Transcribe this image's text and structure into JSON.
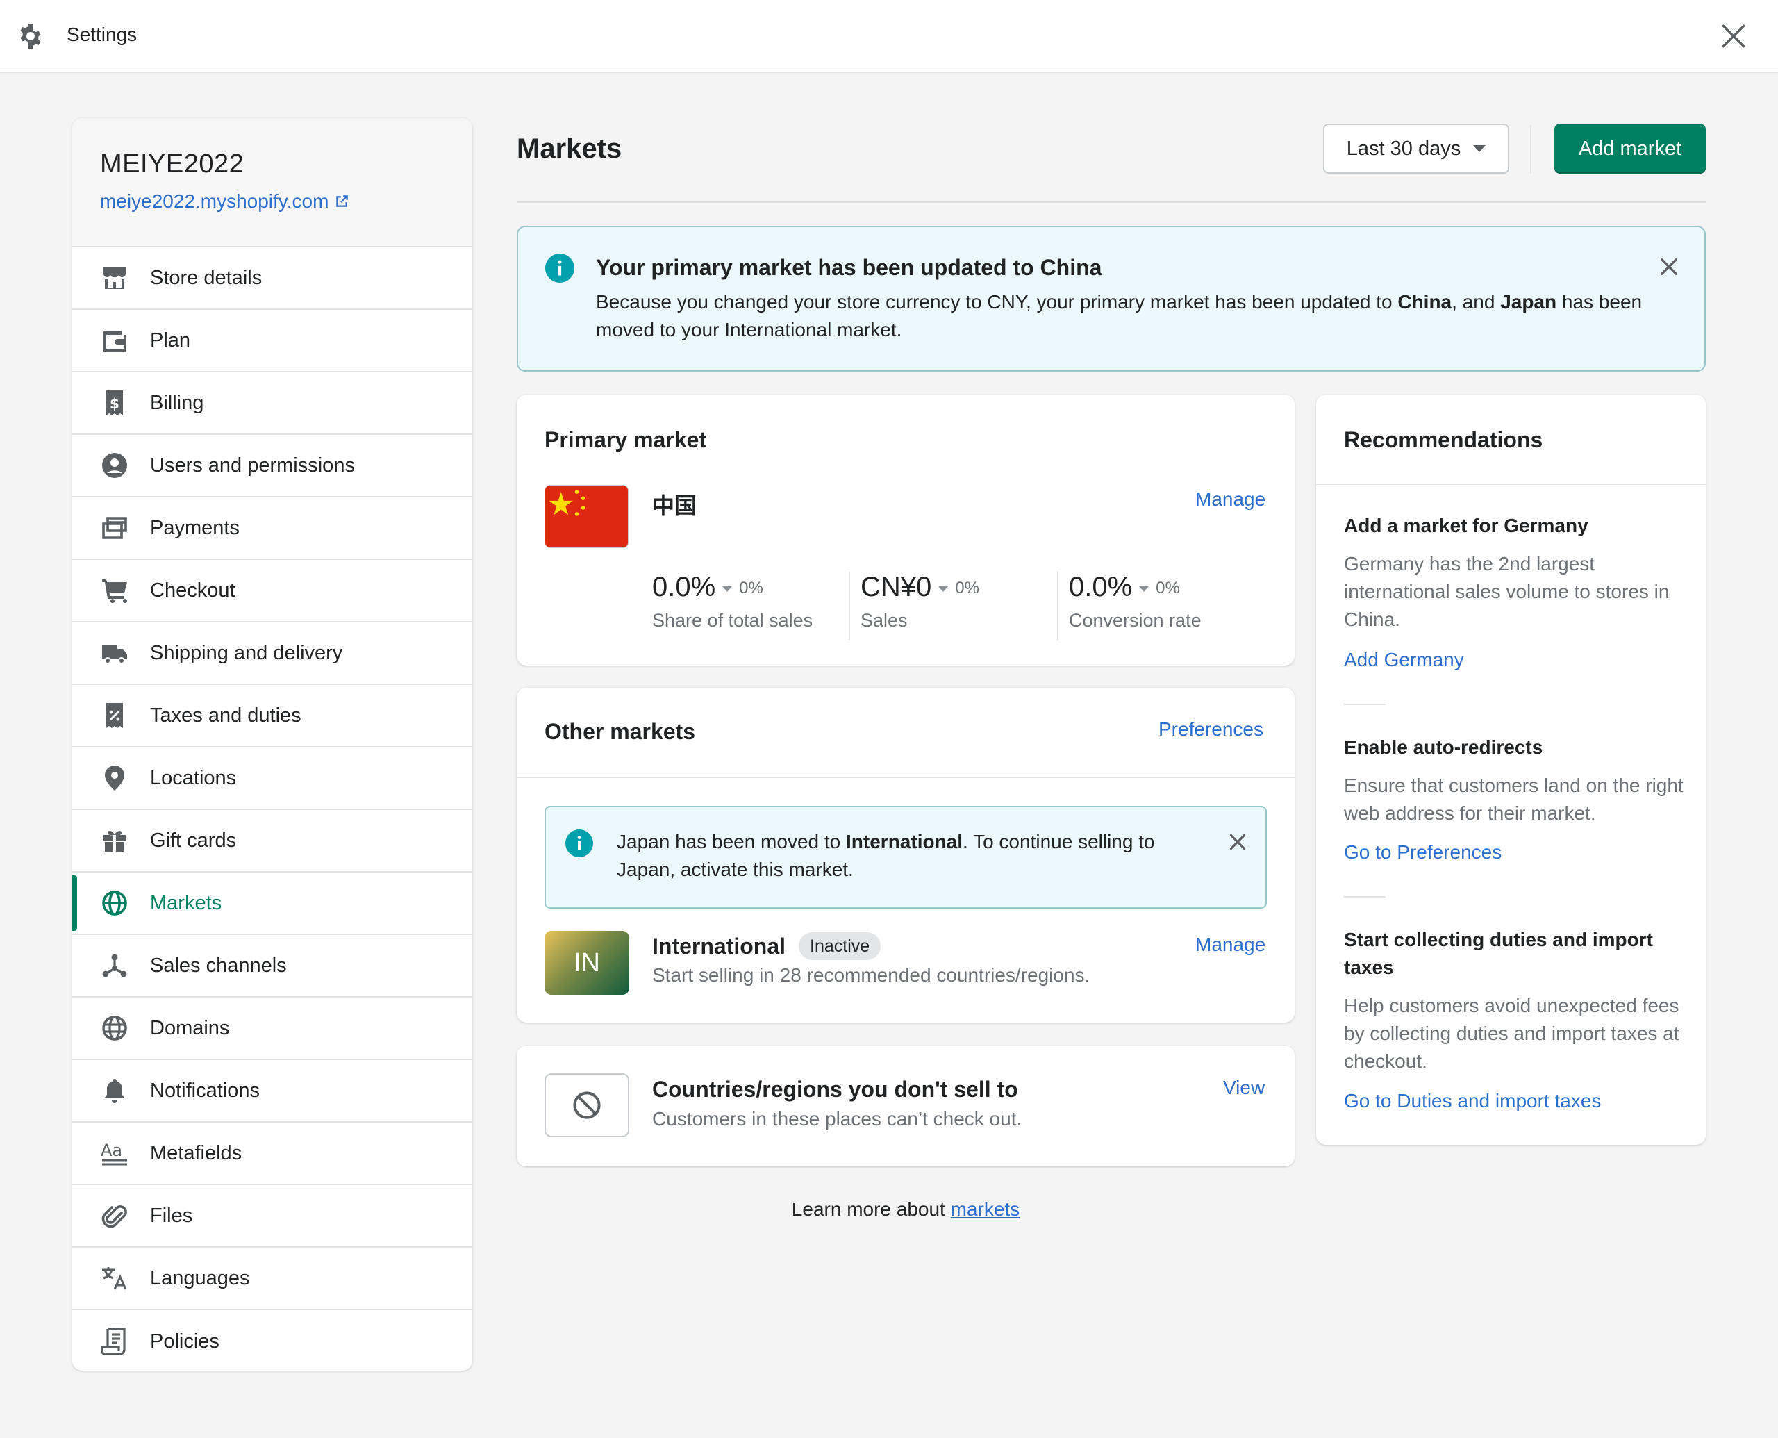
{
  "topbar": {
    "title": "Settings"
  },
  "store": {
    "name": "MEIYE2022",
    "url": "meiye2022.myshopify.com"
  },
  "sidebar": {
    "items": [
      {
        "label": "Store details",
        "icon": "store-icon"
      },
      {
        "label": "Plan",
        "icon": "wallet-icon"
      },
      {
        "label": "Billing",
        "icon": "receipt-dollar-icon"
      },
      {
        "label": "Users and permissions",
        "icon": "user-circle-icon"
      },
      {
        "label": "Payments",
        "icon": "credit-card-icon"
      },
      {
        "label": "Checkout",
        "icon": "cart-icon"
      },
      {
        "label": "Shipping and delivery",
        "icon": "truck-icon"
      },
      {
        "label": "Taxes and duties",
        "icon": "receipt-percent-icon"
      },
      {
        "label": "Locations",
        "icon": "location-pin-icon"
      },
      {
        "label": "Gift cards",
        "icon": "gift-icon"
      },
      {
        "label": "Markets",
        "icon": "globe-icon",
        "active": true
      },
      {
        "label": "Sales channels",
        "icon": "channels-icon"
      },
      {
        "label": "Domains",
        "icon": "domain-globe-icon"
      },
      {
        "label": "Notifications",
        "icon": "bell-icon"
      },
      {
        "label": "Metafields",
        "icon": "metafields-icon"
      },
      {
        "label": "Files",
        "icon": "paperclip-icon"
      },
      {
        "label": "Languages",
        "icon": "translate-icon"
      },
      {
        "label": "Policies",
        "icon": "document-icon"
      }
    ]
  },
  "main": {
    "title": "Markets",
    "date_range": "Last 30 days",
    "add_market": "Add market"
  },
  "banner": {
    "title": "Your primary market has been updated to China",
    "text_1": "Because you changed your store currency to CNY, your primary market has been updated to ",
    "strong_1": "China",
    "text_2": ", and ",
    "strong_2": "Japan",
    "text_3": " has been moved to your International market."
  },
  "primary_market": {
    "heading": "Primary market",
    "name": "中国",
    "manage": "Manage",
    "metrics": [
      {
        "value": "0.0%",
        "change": "0%",
        "caption": "Share of total sales"
      },
      {
        "value": "CN¥0",
        "change": "0%",
        "caption": "Sales"
      },
      {
        "value": "0.0%",
        "change": "0%",
        "caption": "Conversion rate"
      }
    ]
  },
  "other_markets": {
    "heading": "Other markets",
    "preferences": "Preferences",
    "notice_1": "Japan has been moved to ",
    "notice_strong": "International",
    "notice_2": ". To continue selling to Japan, activate this market.",
    "intl_tile": "IN",
    "intl_name": "International",
    "intl_badge": "Inactive",
    "intl_sub": "Start selling in 28 recommended countries/regions.",
    "manage": "Manage"
  },
  "countries": {
    "title": "Countries/regions you don't sell to",
    "sub": "Customers in these places can’t check out.",
    "view": "View"
  },
  "learn": {
    "prefix": "Learn more about ",
    "link": "markets"
  },
  "recommendations": {
    "heading": "Recommendations",
    "items": [
      {
        "title": "Add a market for Germany",
        "text": "Germany has the 2nd largest international sales volume to stores in China.",
        "link": "Add Germany"
      },
      {
        "title": "Enable auto-redirects",
        "text": "Ensure that customers land on the right web address for their market.",
        "link": "Go to Preferences"
      },
      {
        "title": "Start collecting duties and import taxes",
        "text": "Help customers avoid unexpected fees by collecting duties and import taxes at checkout.",
        "link": "Go to Duties and import taxes"
      }
    ]
  },
  "colors": {
    "accent": "#008060",
    "link": "#2c6ecb",
    "info_bg": "#ebf9fc",
    "info_icon": "#00a0ac"
  }
}
